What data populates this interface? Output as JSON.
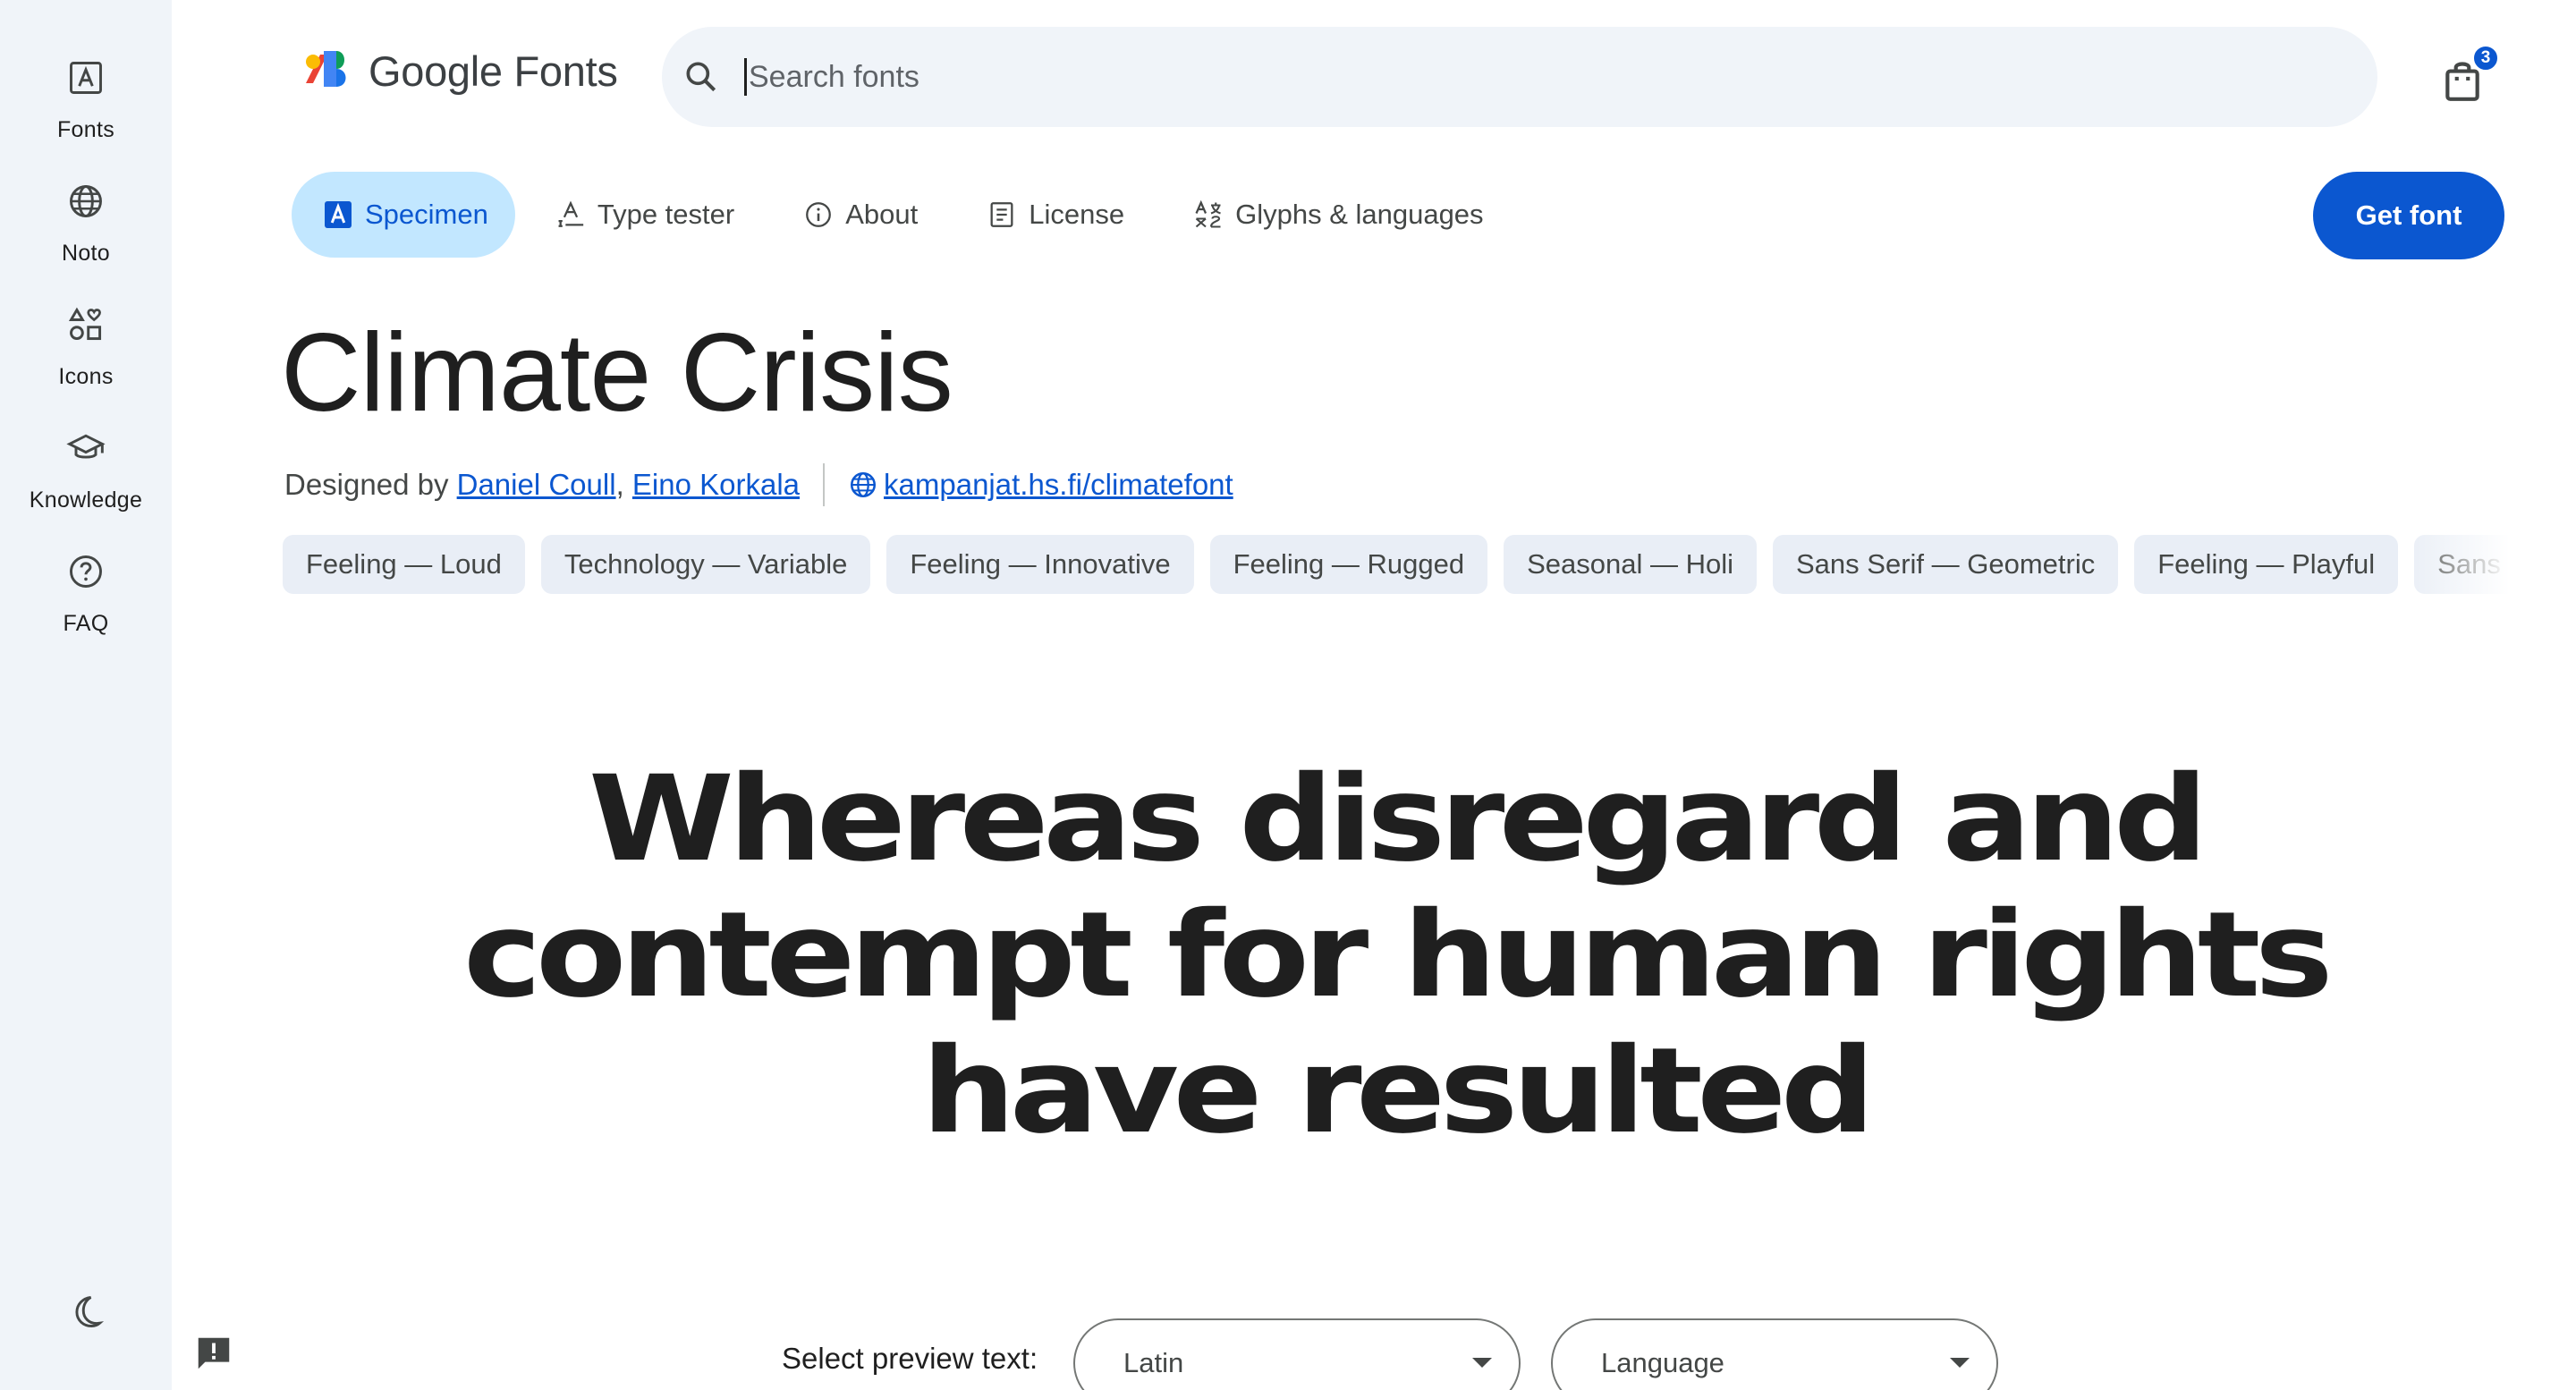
{
  "rail": {
    "items": [
      {
        "label": "Fonts",
        "icon": "fonts-icon"
      },
      {
        "label": "Noto",
        "icon": "globe-icon"
      },
      {
        "label": "Icons",
        "icon": "shapes-icon"
      },
      {
        "label": "Knowledge",
        "icon": "school-icon"
      },
      {
        "label": "FAQ",
        "icon": "help-icon"
      }
    ],
    "theme_icon": "dark-mode-icon"
  },
  "header": {
    "logo_text": "Google Fonts",
    "search_placeholder": "Search fonts",
    "cart_count": "3"
  },
  "tabs": [
    {
      "label": "Specimen",
      "icon": "specimen-icon",
      "active": true
    },
    {
      "label": "Type tester",
      "icon": "type-tester-icon"
    },
    {
      "label": "About",
      "icon": "info-icon"
    },
    {
      "label": "License",
      "icon": "license-icon"
    },
    {
      "label": "Glyphs & languages",
      "icon": "glyphs-icon"
    }
  ],
  "get_font_label": "Get font",
  "font": {
    "title": "Climate Crisis",
    "designed_by_prefix": "Designed by ",
    "designers": [
      "Daniel Coull",
      "Eino Korkala"
    ],
    "designer_separator": ", ",
    "website": "kampanjat.hs.fi/climatefont"
  },
  "tags": [
    "Feeling — Loud",
    "Technology — Variable",
    "Feeling — Innovative",
    "Feeling — Rugged",
    "Seasonal — Holi",
    "Sans Serif — Geometric",
    "Feeling — Playful",
    "Sans Serif — Rounded"
  ],
  "preview": {
    "lines": [
      "Whereas disregard and",
      "contempt for human rights",
      "have resulted"
    ]
  },
  "controls": {
    "select_label": "Select preview text:",
    "script_value": "Latin",
    "language_value": "Language"
  },
  "colors": {
    "accent": "#0b57d0",
    "active_tab_bg": "#c2e7ff",
    "rail_bg": "#f0f4f9",
    "chip_bg": "#e9eef6"
  }
}
